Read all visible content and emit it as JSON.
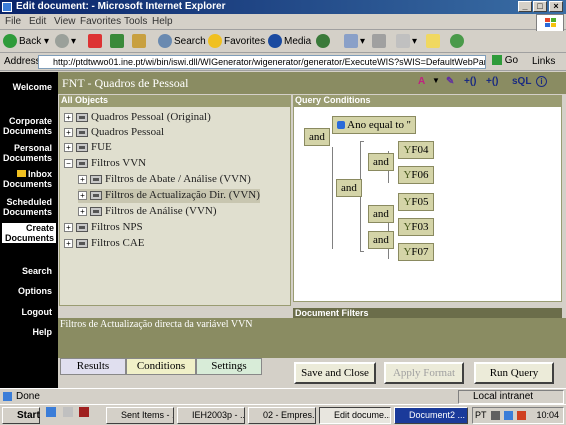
{
  "window": {
    "title": "Edit document: - Microsoft Internet Explorer",
    "controls": [
      "_",
      "□",
      "×"
    ]
  },
  "menu": [
    "File",
    "Edit",
    "View",
    "Favorites",
    "Tools",
    "Help"
  ],
  "toolbar": {
    "back": "Back",
    "search": "Search",
    "favorites": "Favorites",
    "media": "Media"
  },
  "address": {
    "label": "Address",
    "url": "http://ptdtwwo01.ine.pt/wi/bin/iswi.dll/WIGenerator/wigenerator/generator/ExecuteWIS?sWIS=DefaultWebPanelFrame&cont",
    "go": "Go",
    "links": "Links"
  },
  "leftnav": {
    "welcome": "Welcome",
    "corporate": "Corporate Documents",
    "personal": "Personal Documents",
    "inbox": "Inbox Documents",
    "scheduled": "Scheduled Documents",
    "create": "Create Documents",
    "search": "Search",
    "options": "Options",
    "logout": "Logout",
    "help": "Help"
  },
  "app": {
    "title": "FNT - Quadros de Pessoal",
    "header_icons": [
      "A",
      "▼",
      "+()",
      "+()",
      "sQL",
      "i"
    ]
  },
  "objects": {
    "heading": "All Objects",
    "items": [
      {
        "expander": "+",
        "label": "Quadros Pessoal (Original)"
      },
      {
        "expander": "+",
        "label": "Quadros Pessoal"
      },
      {
        "expander": "+",
        "label": "FUE"
      },
      {
        "expander": "−",
        "label": "Filtros VVN"
      },
      {
        "expander": "+",
        "label": "Filtros de Abate / Análise (VVN)"
      },
      {
        "expander": "+",
        "label": "Filtros de Actualização Dir. (VVN)"
      },
      {
        "expander": "+",
        "label": "Filtros de Análise (VVN)"
      },
      {
        "expander": "+",
        "label": "Filtros NPS"
      },
      {
        "expander": "+",
        "label": "Filtros CAE"
      }
    ]
  },
  "query": {
    "heading": "Query Conditions",
    "condition_text": "Ano  equal to  ''",
    "ops": [
      "and",
      "and",
      "and",
      "and",
      "and"
    ],
    "filters": [
      "F04",
      "F06",
      "F05",
      "F03",
      "F07"
    ]
  },
  "filters_heading": "Document Filters",
  "description": "Filtros de Actualização directa da variável VVN",
  "tabs": [
    "Results",
    "Conditions",
    "Settings"
  ],
  "buttons": {
    "save_close": "Save and Close",
    "apply_format": "Apply Format",
    "run_query": "Run Query"
  },
  "status": {
    "text": "Done",
    "zone": "Local intranet"
  },
  "taskbar": {
    "start": "Start",
    "tasks": [
      "Sent Items - ...",
      "IEH2003p - ...",
      "02 - Empres...",
      "Edit docume...",
      "Document2 ..."
    ],
    "tray_label": "PT",
    "clock": "10:04"
  },
  "colors": {
    "olive_header": "#8a8c62",
    "nav_bg": "#000000",
    "filter_box": "#d4d4a8"
  }
}
